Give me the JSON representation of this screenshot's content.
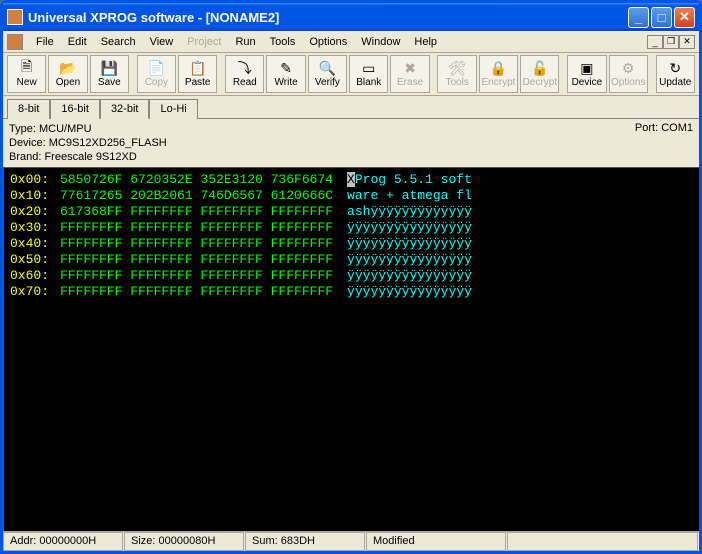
{
  "title": "Universal XPROG software - [NONAME2]",
  "menu": [
    "File",
    "Edit",
    "Search",
    "View",
    "Project",
    "Run",
    "Tools",
    "Options",
    "Window",
    "Help"
  ],
  "menu_disabled": [
    "Project"
  ],
  "toolbar": [
    {
      "id": "new",
      "label": "New",
      "icon": "🗎",
      "disabled": false
    },
    {
      "id": "open",
      "label": "Open",
      "icon": "📂",
      "disabled": false
    },
    {
      "id": "save",
      "label": "Save",
      "icon": "💾",
      "disabled": false
    },
    {
      "sep": true
    },
    {
      "id": "copy",
      "label": "Copy",
      "icon": "📄",
      "disabled": true
    },
    {
      "id": "paste",
      "label": "Paste",
      "icon": "📋",
      "disabled": false
    },
    {
      "sep": true
    },
    {
      "id": "read",
      "label": "Read",
      "icon": "⤵",
      "disabled": false
    },
    {
      "id": "write",
      "label": "Write",
      "icon": "✎",
      "disabled": false
    },
    {
      "id": "verify",
      "label": "Verify",
      "icon": "🔍",
      "disabled": false
    },
    {
      "id": "blank",
      "label": "Blank",
      "icon": "▭",
      "disabled": false
    },
    {
      "id": "erase",
      "label": "Erase",
      "icon": "✖",
      "disabled": true
    },
    {
      "sep": true
    },
    {
      "id": "tools",
      "label": "Tools",
      "icon": "🛠",
      "disabled": true
    },
    {
      "id": "encrypt",
      "label": "Encrypt",
      "icon": "🔒",
      "disabled": true
    },
    {
      "id": "decrypt",
      "label": "Decrypt",
      "icon": "🔓",
      "disabled": true
    },
    {
      "sep": true
    },
    {
      "id": "device",
      "label": "Device",
      "icon": "▣",
      "disabled": false
    },
    {
      "id": "options",
      "label": "Options",
      "icon": "⚙",
      "disabled": true
    },
    {
      "sep": true
    },
    {
      "id": "update",
      "label": "Update",
      "icon": "↻",
      "disabled": false
    }
  ],
  "tabs": [
    "8-bit",
    "16-bit",
    "32-bit",
    "Lo-Hi"
  ],
  "active_tab": "32-bit",
  "info": {
    "type": "Type: MCU/MPU",
    "device": "Device: MC9S12XD256_FLASH",
    "brand": "Brand: Freescale 9S12XD",
    "port": "Port: COM1"
  },
  "hex": [
    {
      "addr": "0x00:",
      "hex": "5850726F 6720352E 352E3120 736F6674",
      "ascii": "XProg 5.5.1 soft"
    },
    {
      "addr": "0x10:",
      "hex": "77617265 202B2061 746D6567 6120666C",
      "ascii": "ware + atmega fl"
    },
    {
      "addr": "0x20:",
      "hex": "617368FF FFFFFFFF FFFFFFFF FFFFFFFF",
      "ascii": "ashÿÿÿÿÿÿÿÿÿÿÿÿÿ"
    },
    {
      "addr": "0x30:",
      "hex": "FFFFFFFF FFFFFFFF FFFFFFFF FFFFFFFF",
      "ascii": "ÿÿÿÿÿÿÿÿÿÿÿÿÿÿÿÿ"
    },
    {
      "addr": "0x40:",
      "hex": "FFFFFFFF FFFFFFFF FFFFFFFF FFFFFFFF",
      "ascii": "ÿÿÿÿÿÿÿÿÿÿÿÿÿÿÿÿ"
    },
    {
      "addr": "0x50:",
      "hex": "FFFFFFFF FFFFFFFF FFFFFFFF FFFFFFFF",
      "ascii": "ÿÿÿÿÿÿÿÿÿÿÿÿÿÿÿÿ"
    },
    {
      "addr": "0x60:",
      "hex": "FFFFFFFF FFFFFFFF FFFFFFFF FFFFFFFF",
      "ascii": "ÿÿÿÿÿÿÿÿÿÿÿÿÿÿÿÿ"
    },
    {
      "addr": "0x70:",
      "hex": "FFFFFFFF FFFFFFFF FFFFFFFF FFFFFFFF",
      "ascii": "ÿÿÿÿÿÿÿÿÿÿÿÿÿÿÿÿ"
    }
  ],
  "status": {
    "addr": "Addr: 00000000H",
    "size": "Size: 00000080H",
    "sum": "Sum: 683DH",
    "modified": "Modified"
  }
}
